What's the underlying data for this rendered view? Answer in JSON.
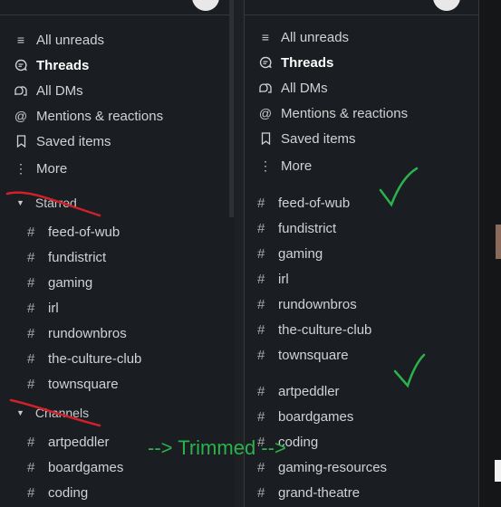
{
  "left_panel": {
    "nav": [
      {
        "icon": "list-icon",
        "label": "All unreads",
        "bold": false
      },
      {
        "icon": "threads-icon",
        "label": "Threads",
        "bold": true
      },
      {
        "icon": "dms-icon",
        "label": "All DMs",
        "bold": false
      },
      {
        "icon": "at-icon",
        "label": "Mentions & reactions",
        "bold": false
      },
      {
        "icon": "bookmark-icon",
        "label": "Saved items",
        "bold": false
      },
      {
        "icon": "more-icon",
        "label": "More",
        "bold": false
      }
    ],
    "starred_header": "Starred",
    "starred": [
      "feed-of-wub",
      "fundistrict",
      "gaming",
      "irl",
      "rundownbros",
      "the-culture-club",
      "townsquare"
    ],
    "channels_header": "Channels",
    "channels": [
      "artpeddler",
      "boardgames",
      "coding"
    ]
  },
  "right_panel": {
    "nav": [
      {
        "icon": "list-icon",
        "label": "All unreads",
        "bold": false
      },
      {
        "icon": "threads-icon",
        "label": "Threads",
        "bold": true
      },
      {
        "icon": "dms-icon",
        "label": "All DMs",
        "bold": false
      },
      {
        "icon": "at-icon",
        "label": "Mentions & reactions",
        "bold": false
      },
      {
        "icon": "bookmark-icon",
        "label": "Saved items",
        "bold": false
      },
      {
        "icon": "more-icon",
        "label": "More",
        "bold": false
      }
    ],
    "group1": [
      "feed-of-wub",
      "fundistrict",
      "gaming",
      "irl",
      "rundownbros",
      "the-culture-club",
      "townsquare"
    ],
    "group2": [
      "artpeddler",
      "boardgames",
      "coding",
      "gaming-resources",
      "grand-theatre"
    ]
  },
  "annotation": {
    "text": "--> Trimmed -->",
    "red_color": "#d0202a",
    "green_color": "#2bb24c"
  },
  "hash_symbol": "#"
}
